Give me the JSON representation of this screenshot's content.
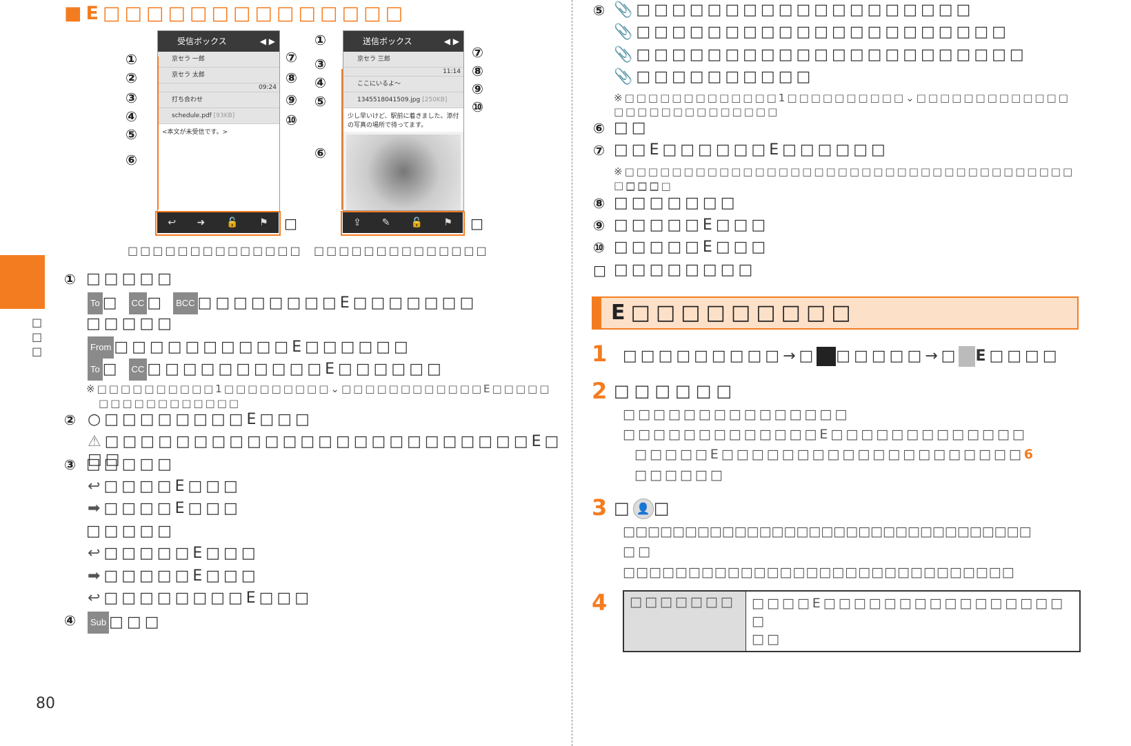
{
  "page_number": "80",
  "side_tab": "□□□",
  "title": {
    "mark": "■",
    "text": "E□□□□□□□□□□□□□□"
  },
  "phones": [
    {
      "header": "受信ボックス",
      "from": "京セラ 一郎",
      "to": "京セラ 太郎",
      "time": "09:24",
      "subject": "打ち合わせ",
      "attachment": "schedule.pdf",
      "size": "[93KB]",
      "body": "<本文が未受信です。>",
      "caption": "□□□□□□□□□□□□□□"
    },
    {
      "header": "送信ボックス",
      "to": "京セラ 三郎",
      "time": "11:14",
      "subject": "ここにいるよ～",
      "attachment": "1345518041509.jpg",
      "size": "[250KB]",
      "body": "少し早いけど、駅前に着きました。添付の写真の場所で待ってます。",
      "caption": "□□□□□□□□□□□□□□"
    }
  ],
  "callouts": [
    "①",
    "②",
    "③",
    "④",
    "⑤",
    "⑥",
    "⑦",
    "⑧",
    "⑨",
    "⑩",
    "□"
  ],
  "badges": {
    "to": "To",
    "cc": "CC",
    "bcc": "BCC",
    "from": "From",
    "sub": "Sub"
  },
  "left": {
    "i1": "□□□□□",
    "i1a": "□□□□□□□□E□□□□□□□",
    "i1b": "□□□□□",
    "i1c": "□□□□□□□□□□E□□□□□□",
    "i1d": "□□□□□□□□□□E□□□□□□",
    "n1a": "※□□□□□□□□□□1□□□□□□□□□",
    "n1b": "□□□□□□□□□□□□E□□□□□",
    "n1c": "□□□□□□□□□□□□",
    "i2": "□□□□□□□□E□□□",
    "i2a": "□□□□□□□□□□□□□□□□□□□□□□□□E□□□",
    "i3": "□□□□□",
    "i3a": "□□□□E□□□",
    "i3b": "□□□□E□□□",
    "i3c": "□□□□□",
    "i3d": "□□□□□E□□□",
    "i3e": "□□□□□E□□□",
    "i3f": "□□□□□□□□E□□□",
    "i4": "□□□"
  },
  "right": {
    "i5a": "□□□□□□□□□□□□□□□□□□□",
    "i5b": "□□□□□□□□□□□□□□□□□□□□□",
    "i5c": "□□□□□□□□□□□□□□□□□□□□□□",
    "i5d": "□□□□□□□□□□",
    "n5a": "※□□□□□□□□□□□□□1□□□□□□□□□□",
    "n5b": "□□□□□□□□□□□□□□",
    "n5c": "□□□□□□□□□□□□□",
    "i6": "□□",
    "i7": "□□E□□□□□□E□□□□□□",
    "n7a": "※□□□□□□□□□□□□□□□□□□□□□□□□□□□□□□□□□□□□□□□□□□",
    "n7b": "□□□□",
    "i8": "□□□□□□□",
    "i9": "□□□□□E□□□",
    "i10": "□□□□□E□□□",
    "i11": "□□□□□□□□"
  },
  "section": {
    "title": "E□□□□□□□□□",
    "color": "#f47c20",
    "bg": "#fde0c8"
  },
  "steps": [
    {
      "n": "1",
      "a": "□□□□□□□□□→□",
      "b": "□□□□□→□",
      "c": "E□□□□"
    },
    {
      "n": "2",
      "a": "□□□□□□",
      "l1": "□□□□□□□□□□□□□□□",
      "l2": "□□□□□□□□□□□□□E□□□□□□□□□□□□□",
      "l3": "□□□□□E□□□□□□□□□□□□□□□□□□□□",
      "l3n": "6",
      "l4": "□□□□□□"
    },
    {
      "n": "3",
      "a": "□",
      "b": "□",
      "l1": "□□□□□□□□□□□□□□□□□□□□□□□□□□□□□□□□□",
      "l2": "□□",
      "l3": "□□□□□□□□□□□□□□□□□□□□□□□□□□□□□□"
    },
    {
      "n": "4",
      "cell1": "□□□□□□□",
      "cell2a": "□□□□E□□□□□□□□□□□□□□□□□",
      "cell2b": "□□"
    }
  ]
}
